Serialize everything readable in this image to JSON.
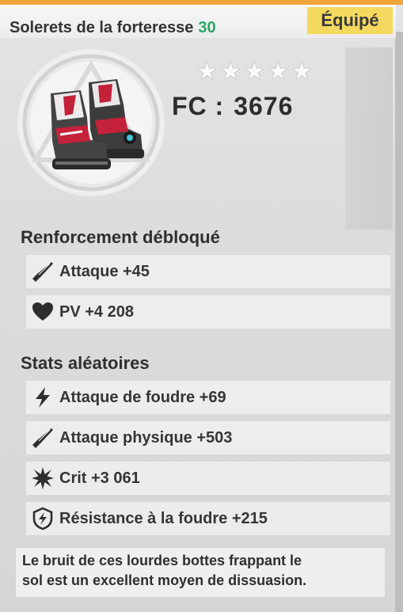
{
  "item": {
    "name": "Solerets de la forteresse",
    "level": "30",
    "equipped_label": "Équipé",
    "stars": 5,
    "fc_label": "FC :",
    "fc_value": "3676"
  },
  "unlocked_section": {
    "title": "Renforcement débloqué",
    "stats": [
      {
        "icon": "sword-icon",
        "label": "Attaque +45"
      },
      {
        "icon": "heart-icon",
        "label": "PV +4 208"
      }
    ]
  },
  "random_section": {
    "title": "Stats aléatoires",
    "stats": [
      {
        "icon": "lightning-icon",
        "label": "Attaque de foudre +69"
      },
      {
        "icon": "sword-icon",
        "label": "Attaque physique +503"
      },
      {
        "icon": "burst-icon",
        "label": "Crit +3 061"
      },
      {
        "icon": "lightning-shield-icon",
        "label": "Résistance à la foudre +215"
      }
    ]
  },
  "description": {
    "line1": "Le bruit de ces lourdes bottes frappant le",
    "line2": "sol est un excellent moyen de dissuasion."
  },
  "colors": {
    "accent": "#f0a43a",
    "level": "#2aa46b",
    "badge": "#f5d95e",
    "boots_red": "#c4213a"
  }
}
